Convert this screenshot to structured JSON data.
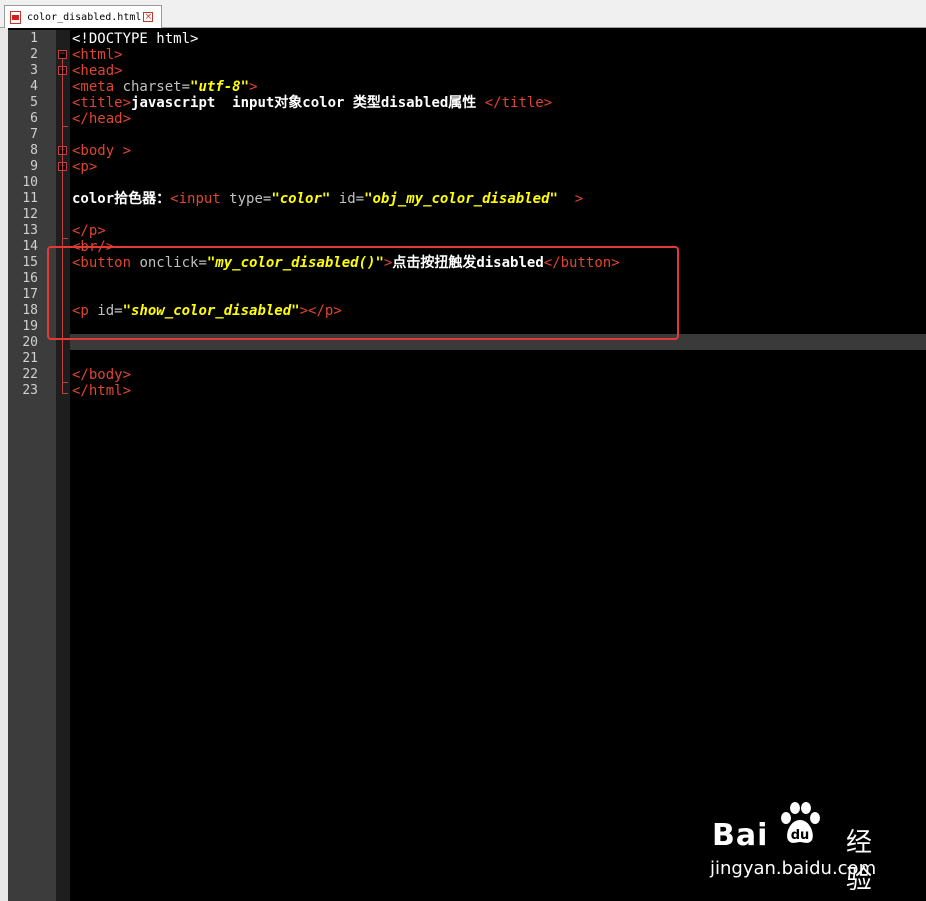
{
  "tab": {
    "filename": "color_disabled.html",
    "close_glyph": "×",
    "file_icon": "html-file-icon"
  },
  "lines": [
    {
      "n": "1",
      "tokens": [
        [
          "plain",
          "<!DOCTYPE html>"
        ]
      ]
    },
    {
      "n": "2",
      "tokens": [
        [
          "tag",
          "<html>"
        ]
      ]
    },
    {
      "n": "3",
      "tokens": [
        [
          "tag",
          "<head>"
        ]
      ]
    },
    {
      "n": "4",
      "tokens": [
        [
          "tag",
          "<meta "
        ],
        [
          "attr",
          "charset="
        ],
        [
          "str",
          "\"utf-8\""
        ],
        [
          "tag",
          ">"
        ]
      ]
    },
    {
      "n": "5",
      "tokens": [
        [
          "tag",
          "<title>"
        ],
        [
          "txt",
          "javascript  input对象color 类型disabled属性 "
        ],
        [
          "tag",
          "</title>"
        ]
      ]
    },
    {
      "n": "6",
      "tokens": [
        [
          "tag",
          "</head>"
        ]
      ]
    },
    {
      "n": "7",
      "tokens": []
    },
    {
      "n": "8",
      "tokens": [
        [
          "tag",
          "<body >"
        ]
      ]
    },
    {
      "n": "9",
      "tokens": [
        [
          "tag",
          "<p>"
        ]
      ]
    },
    {
      "n": "10",
      "tokens": []
    },
    {
      "n": "11",
      "tokens": [
        [
          "txt",
          "color拾色器："
        ],
        [
          "tag",
          "<input "
        ],
        [
          "attr",
          "type="
        ],
        [
          "str",
          "\"color\""
        ],
        [
          "attr",
          " id="
        ],
        [
          "str",
          "\"obj_my_color_disabled\""
        ],
        [
          "tag",
          "  >"
        ]
      ]
    },
    {
      "n": "12",
      "tokens": []
    },
    {
      "n": "13",
      "tokens": [
        [
          "tag",
          "</p>"
        ]
      ]
    },
    {
      "n": "14",
      "tokens": [
        [
          "tag",
          "<br/>"
        ]
      ]
    },
    {
      "n": "15",
      "tokens": [
        [
          "tag",
          "<button "
        ],
        [
          "attr",
          "onclick="
        ],
        [
          "str",
          "\"my_color_disabled()\""
        ],
        [
          "tag",
          ">"
        ],
        [
          "txt",
          "点击按扭触发disabled"
        ],
        [
          "tag",
          "</button>"
        ]
      ]
    },
    {
      "n": "16",
      "tokens": []
    },
    {
      "n": "17",
      "tokens": []
    },
    {
      "n": "18",
      "tokens": [
        [
          "tag",
          "<p "
        ],
        [
          "attr",
          "id="
        ],
        [
          "str",
          "\"show_color_disabled\""
        ],
        [
          "tag",
          "></p>"
        ]
      ]
    },
    {
      "n": "19",
      "tokens": []
    },
    {
      "n": "20",
      "tokens": []
    },
    {
      "n": "21",
      "tokens": []
    },
    {
      "n": "22",
      "tokens": [
        [
          "tag",
          "</body>"
        ]
      ]
    },
    {
      "n": "23",
      "tokens": [
        [
          "tag",
          "</html>"
        ]
      ]
    }
  ],
  "watermark": {
    "brand": "Bai",
    "brand_suffix": "经验",
    "url": "jingyan.baidu.com",
    "logo_icon": "baidu-paw-icon"
  },
  "colors": {
    "tag": "#e0452f",
    "attr": "#c0c0c0",
    "string": "#ffff00",
    "text": "#ffffff",
    "highlight_box": "#e53935"
  }
}
